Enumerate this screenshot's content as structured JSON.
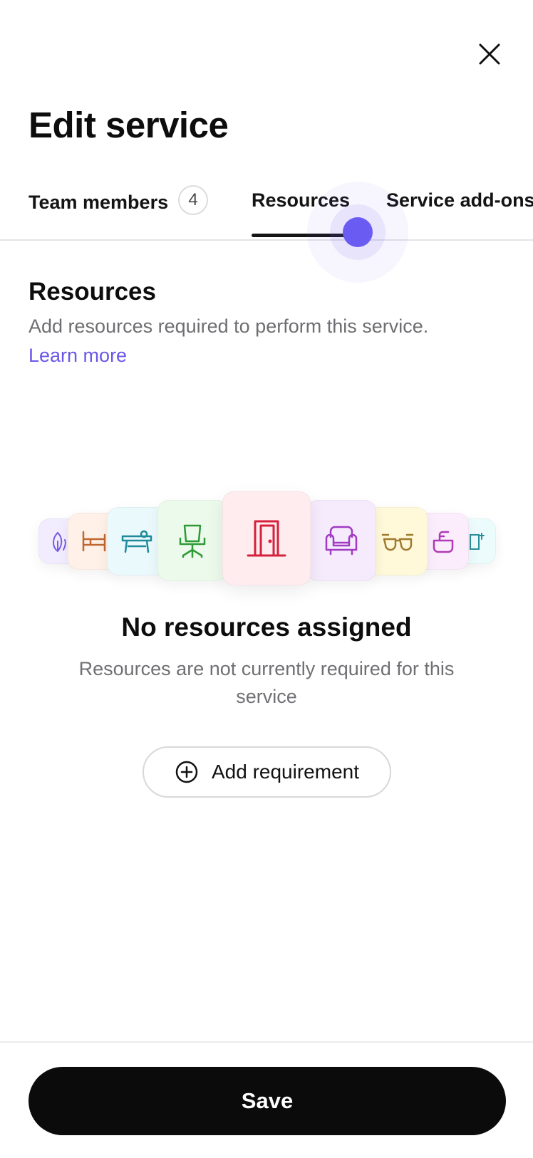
{
  "header": {
    "title": "Edit service",
    "close_icon": "close-icon"
  },
  "tabs": [
    {
      "label": "Team members",
      "badge": "4",
      "active": false
    },
    {
      "label": "Resources",
      "active": true
    },
    {
      "label": "Service add-ons",
      "active": false
    }
  ],
  "section": {
    "title": "Resources",
    "description": "Add resources required to perform this service.",
    "learn_more": "Learn more"
  },
  "illustration": {
    "cards": [
      {
        "icon": "plant-icon",
        "color": "#7b5ce0",
        "bg": "#f1edff"
      },
      {
        "icon": "bed-icon",
        "color": "#c0662e",
        "bg": "#fff1e8"
      },
      {
        "icon": "massage-table-icon",
        "color": "#1f8a9a",
        "bg": "#eaf9fb"
      },
      {
        "icon": "chair-icon",
        "color": "#2e9a36",
        "bg": "#ecfaec"
      },
      {
        "icon": "door-icon",
        "color": "#d4213d",
        "bg": "#ffecef"
      },
      {
        "icon": "armchair-icon",
        "color": "#a03ac2",
        "bg": "#f6eafd"
      },
      {
        "icon": "glasses-icon",
        "color": "#a07a2e",
        "bg": "#fff9d9"
      },
      {
        "icon": "sink-icon",
        "color": "#b13ab6",
        "bg": "#fbedfc"
      },
      {
        "icon": "mirror-icon",
        "color": "#2a8f9a",
        "bg": "#ecfbfb"
      }
    ]
  },
  "empty_state": {
    "title": "No resources assigned",
    "description": "Resources are not currently required for this service",
    "button_label": "Add requirement",
    "button_icon": "plus-circle-icon"
  },
  "footer": {
    "save_label": "Save"
  }
}
